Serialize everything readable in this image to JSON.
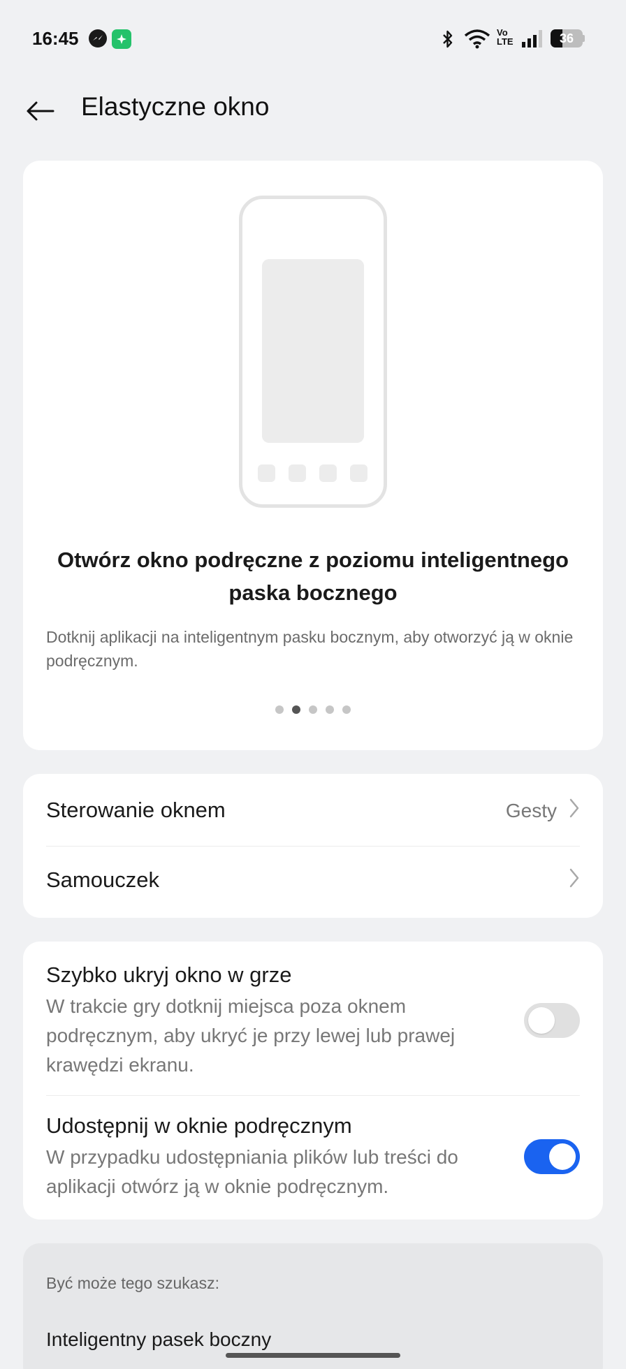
{
  "status_bar": {
    "time": "16:45",
    "battery_level": "36",
    "battery_fraction": 0.36,
    "icons": [
      "messenger-icon",
      "green-app-icon",
      "bluetooth-icon",
      "wifi-icon",
      "volte-icon",
      "signal-icon",
      "battery-icon"
    ],
    "volte_label_top": "Vo",
    "volte_label_bottom": "LTE"
  },
  "header": {
    "back_icon": "arrow-left-icon",
    "title": "Elastyczne okno"
  },
  "intro": {
    "title": "Otwórz okno podręczne z poziomu inteligentnego paska bocznego",
    "description": "Dotknij aplikacji na inteligentnym pasku bocznym, aby otworzyć ją w oknie podręcznym.",
    "page_count": 5,
    "active_page": 2
  },
  "settings": {
    "window_control": {
      "label": "Sterowanie oknem",
      "value": "Gesty"
    },
    "tutorial": {
      "label": "Samouczek"
    }
  },
  "toggles": [
    {
      "title": "Szybko ukryj okno w grze",
      "description": "W trakcie gry dotknij miejsca poza oknem podręcznym, aby ukryć je przy lewej lub prawej krawędzi ekranu.",
      "enabled": false
    },
    {
      "title": "Udostępnij w oknie podręcznym",
      "description": "W przypadku udostępniania plików lub treści do aplikacji otwórz ją w oknie podręcznym.",
      "enabled": true
    }
  ],
  "suggestions": {
    "header": "Być może tego szukasz:",
    "items": [
      "Inteligentny pasek boczny"
    ]
  },
  "colors": {
    "background": "#f0f1f3",
    "accent": "#1a63f0",
    "card": "#ffffff"
  }
}
